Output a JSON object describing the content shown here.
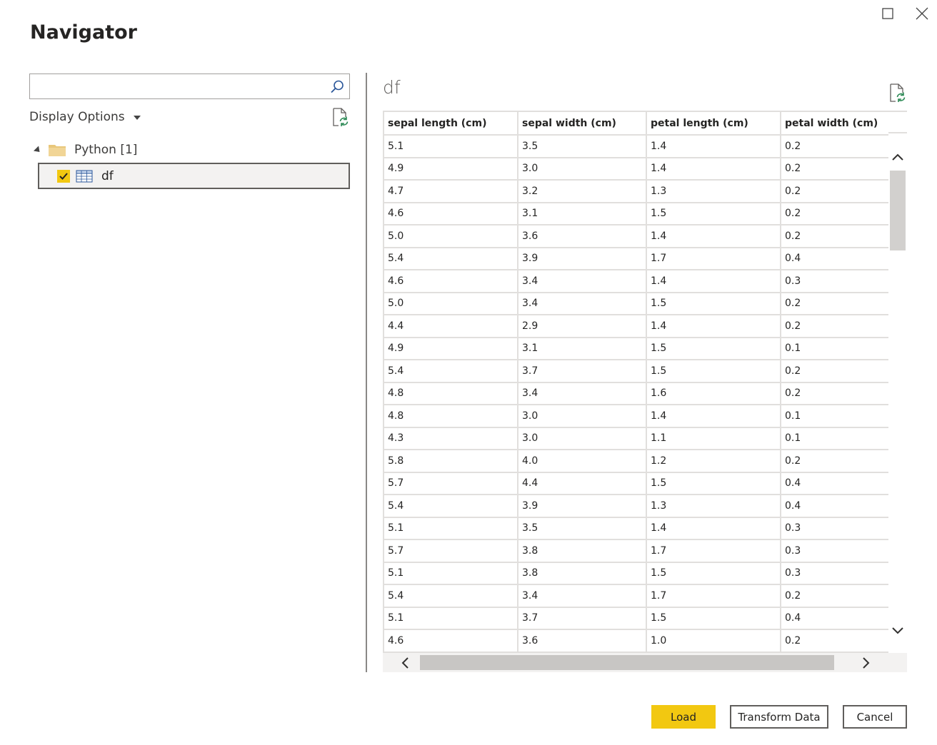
{
  "window": {
    "title": "Navigator"
  },
  "search": {
    "value": "",
    "placeholder": ""
  },
  "display_options": {
    "label": "Display Options"
  },
  "tree": {
    "source": {
      "label": "Python [1]"
    },
    "item": {
      "label": "df",
      "checked": true
    }
  },
  "preview": {
    "title": "df",
    "columns": [
      "sepal length (cm)",
      "sepal width (cm)",
      "petal length (cm)",
      "petal width (cm)"
    ],
    "rows": [
      [
        "5.1",
        "3.5",
        "1.4",
        "0.2"
      ],
      [
        "4.9",
        "3.0",
        "1.4",
        "0.2"
      ],
      [
        "4.7",
        "3.2",
        "1.3",
        "0.2"
      ],
      [
        "4.6",
        "3.1",
        "1.5",
        "0.2"
      ],
      [
        "5.0",
        "3.6",
        "1.4",
        "0.2"
      ],
      [
        "5.4",
        "3.9",
        "1.7",
        "0.4"
      ],
      [
        "4.6",
        "3.4",
        "1.4",
        "0.3"
      ],
      [
        "5.0",
        "3.4",
        "1.5",
        "0.2"
      ],
      [
        "4.4",
        "2.9",
        "1.4",
        "0.2"
      ],
      [
        "4.9",
        "3.1",
        "1.5",
        "0.1"
      ],
      [
        "5.4",
        "3.7",
        "1.5",
        "0.2"
      ],
      [
        "4.8",
        "3.4",
        "1.6",
        "0.2"
      ],
      [
        "4.8",
        "3.0",
        "1.4",
        "0.1"
      ],
      [
        "4.3",
        "3.0",
        "1.1",
        "0.1"
      ],
      [
        "5.8",
        "4.0",
        "1.2",
        "0.2"
      ],
      [
        "5.7",
        "4.4",
        "1.5",
        "0.4"
      ],
      [
        "5.4",
        "3.9",
        "1.3",
        "0.4"
      ],
      [
        "5.1",
        "3.5",
        "1.4",
        "0.3"
      ],
      [
        "5.7",
        "3.8",
        "1.7",
        "0.3"
      ],
      [
        "5.1",
        "3.8",
        "1.5",
        "0.3"
      ],
      [
        "5.4",
        "3.4",
        "1.7",
        "0.2"
      ],
      [
        "5.1",
        "3.7",
        "1.5",
        "0.4"
      ],
      [
        "4.6",
        "3.6",
        "1.0",
        "0.2"
      ]
    ]
  },
  "footer": {
    "load": "Load",
    "transform": "Transform Data",
    "cancel": "Cancel"
  },
  "colors": {
    "accent": "#f2c811",
    "border": "#605e5c",
    "grid": "#e1dfdd"
  }
}
